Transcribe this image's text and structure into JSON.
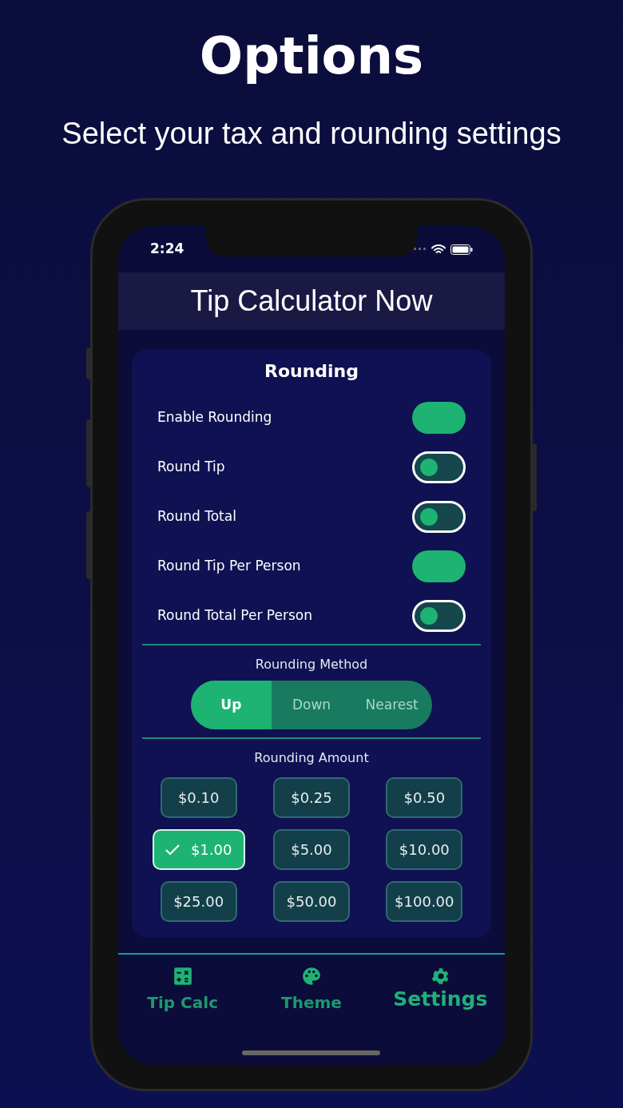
{
  "headline": "Options",
  "subtitle": "Select your tax and rounding settings",
  "status_bar": {
    "time": "2:24"
  },
  "app_title": "Tip Calculator Now",
  "card_title": "Rounding",
  "toggles": [
    {
      "label": "Enable Rounding",
      "on": true
    },
    {
      "label": "Round Tip",
      "on": false
    },
    {
      "label": "Round Total",
      "on": false
    },
    {
      "label": "Round Tip Per Person",
      "on": true
    },
    {
      "label": "Round Total Per Person",
      "on": false
    }
  ],
  "method": {
    "label": "Rounding Method",
    "options": [
      {
        "label": "Up",
        "selected": true
      },
      {
        "label": "Down",
        "selected": false
      },
      {
        "label": "Nearest",
        "selected": false
      }
    ]
  },
  "amount": {
    "label": "Rounding Amount",
    "options": [
      {
        "label": "$0.10",
        "selected": false
      },
      {
        "label": "$0.25",
        "selected": false
      },
      {
        "label": "$0.50",
        "selected": false
      },
      {
        "label": "$1.00",
        "selected": true
      },
      {
        "label": "$5.00",
        "selected": false
      },
      {
        "label": "$10.00",
        "selected": false
      },
      {
        "label": "$25.00",
        "selected": false
      },
      {
        "label": "$50.00",
        "selected": false
      },
      {
        "label": "$100.00",
        "selected": false
      }
    ]
  },
  "tab_bar": [
    {
      "label": "Tip Calc",
      "kind": "calculator",
      "selected": false
    },
    {
      "label": "Theme",
      "kind": "palette",
      "selected": false
    },
    {
      "label": "Settings",
      "kind": "gear",
      "selected": true
    }
  ]
}
